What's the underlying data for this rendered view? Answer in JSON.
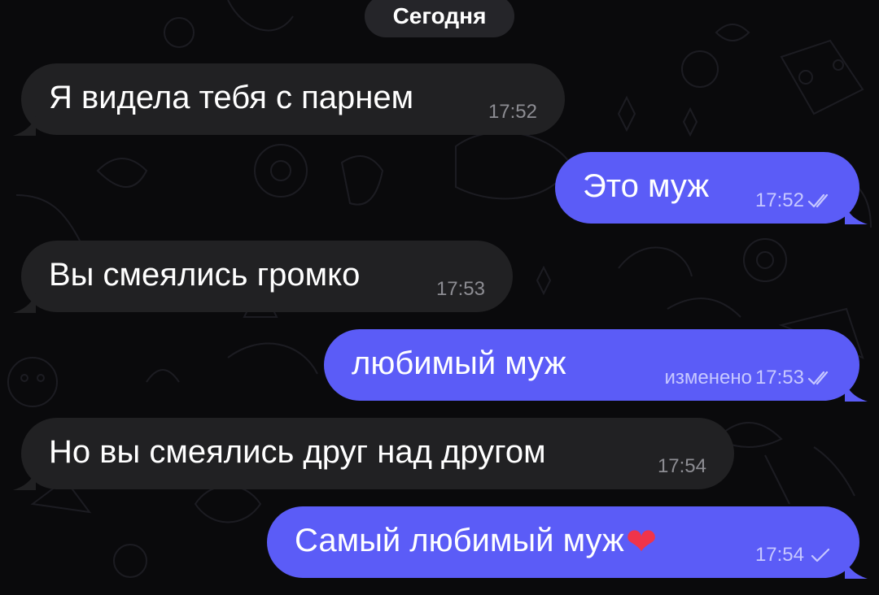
{
  "chat": {
    "date_label": "Сегодня",
    "colors": {
      "background": "#0a0a0c",
      "incoming_bubble": "#212123",
      "outgoing_bubble": "#5b5cf7",
      "heart": "#f0344a"
    },
    "messages": [
      {
        "direction": "incoming",
        "text": "Я видела тебя с парнем",
        "time": "17:52"
      },
      {
        "direction": "outgoing",
        "text": "Это муж",
        "time": "17:52",
        "status": "read"
      },
      {
        "direction": "incoming",
        "text": "Вы смеялись громко",
        "time": "17:53"
      },
      {
        "direction": "outgoing",
        "text": "любимый муж",
        "edited_label": "изменено",
        "time": "17:53",
        "status": "read"
      },
      {
        "direction": "incoming",
        "text": "Но вы смеялись друг над другом",
        "time": "17:54"
      },
      {
        "direction": "outgoing",
        "text": "Самый любимый муж",
        "emoji": "heart",
        "time": "17:54",
        "status": "sent"
      }
    ]
  }
}
